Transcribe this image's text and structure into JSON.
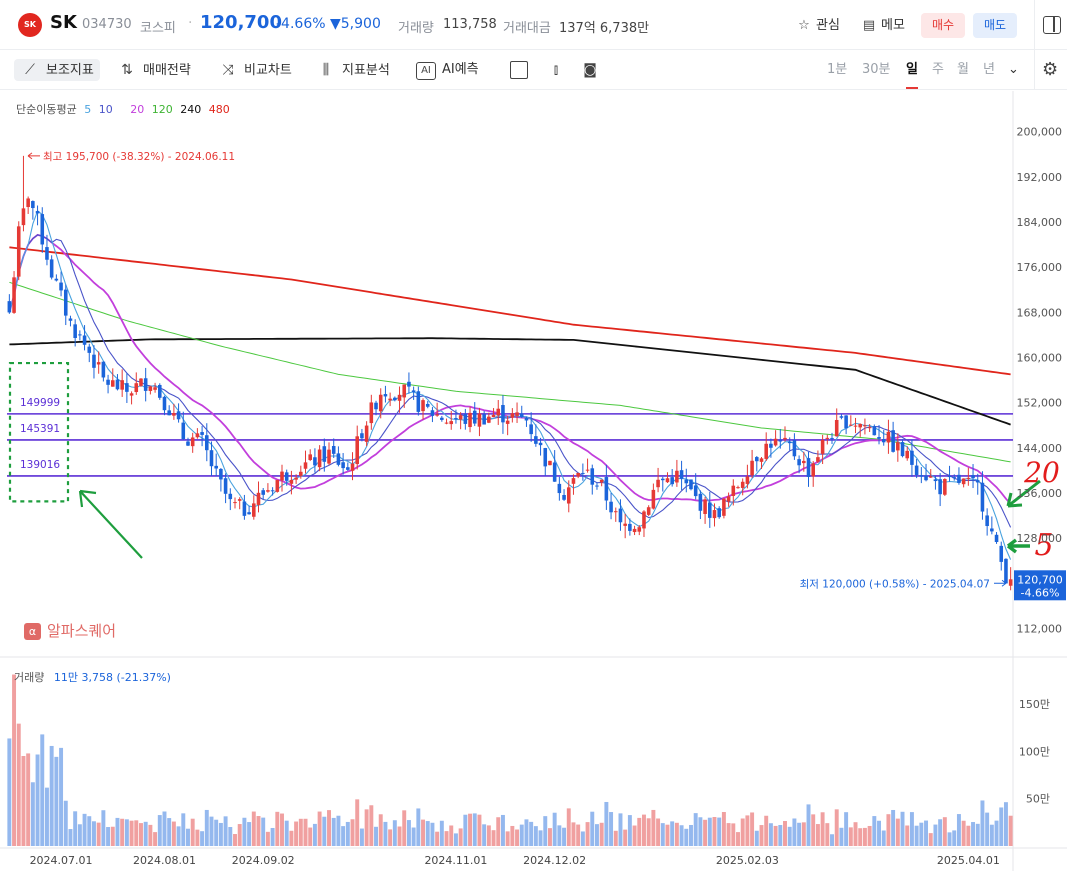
{
  "header": {
    "logo_text": "SK",
    "name": "SK",
    "code": "034730",
    "market": "코스피",
    "separator": "·",
    "price": "120,700",
    "change_pct": "-4.66%",
    "change": "▼5,900",
    "volume_label": "거래량",
    "volume_value": "113,758",
    "amount_label": "거래대금",
    "amount_value": "137억 6,738만",
    "watch_label": "관심",
    "memo_label": "메모",
    "buy_label": "매수",
    "sell_label": "매도",
    "up_color": "#e53935",
    "down_color": "#1b64da"
  },
  "toolbar": {
    "indicator_label": "보조지표",
    "strategy_label": "매매전략",
    "compare_label": "비교차트",
    "analysis_label": "지표분석",
    "ai_label": "AI예측",
    "periods": [
      "1분",
      "30분",
      "일",
      "주",
      "월",
      "년"
    ],
    "active_period": "일"
  },
  "ma_legend": {
    "title": "단순이동평균",
    "items": [
      {
        "label": "5",
        "color": "#4aa3df"
      },
      {
        "label": "10",
        "color": "#4a54c9"
      },
      {
        "label": "20",
        "color": "#c23fdc"
      },
      {
        "label": "120",
        "color": "#4cc83f"
      },
      {
        "label": "240",
        "color": "#111111"
      },
      {
        "label": "480",
        "color": "#e0251b"
      }
    ]
  },
  "brand": {
    "icon": "α",
    "label": "알파스퀘어"
  },
  "chart_data": {
    "type": "candlestick",
    "y_axis": {
      "ticks": [
        "200,000",
        "192,000",
        "184,000",
        "176,000",
        "168,000",
        "160,000",
        "152,000",
        "144,000",
        "136,000",
        "128,000",
        "120,000",
        "112,000"
      ],
      "range": [
        108000,
        204000
      ]
    },
    "x_axis": {
      "ticks": [
        "2024.07.01",
        "2024.08.01",
        "2024.09.02",
        "2024.11.01",
        "2024.12.02",
        "2025.02.03",
        "2025.04.01"
      ]
    },
    "close_keyframes": [
      [
        0,
        168000
      ],
      [
        2,
        182000
      ],
      [
        4,
        189000
      ],
      [
        6,
        184000
      ],
      [
        9,
        175000
      ],
      [
        13,
        166000
      ],
      [
        17,
        161000
      ],
      [
        20,
        156000
      ],
      [
        25,
        154000
      ],
      [
        30,
        156000
      ],
      [
        34,
        151000
      ],
      [
        37,
        146000
      ],
      [
        41,
        145000
      ],
      [
        44,
        139000
      ],
      [
        47,
        134000
      ],
      [
        50,
        133000
      ],
      [
        54,
        136000
      ],
      [
        58,
        139000
      ],
      [
        63,
        141000
      ],
      [
        68,
        143000
      ],
      [
        72,
        140000
      ],
      [
        75,
        147000
      ],
      [
        79,
        154000
      ],
      [
        84,
        154000
      ],
      [
        88,
        151000
      ],
      [
        93,
        149000
      ],
      [
        98,
        149000
      ],
      [
        104,
        150000
      ],
      [
        110,
        149000
      ],
      [
        114,
        142000
      ],
      [
        118,
        136000
      ],
      [
        122,
        140000
      ],
      [
        126,
        137000
      ],
      [
        130,
        130000
      ],
      [
        134,
        131000
      ],
      [
        138,
        138000
      ],
      [
        142,
        139000
      ],
      [
        146,
        135000
      ],
      [
        150,
        132000
      ],
      [
        154,
        136000
      ],
      [
        158,
        142000
      ],
      [
        162,
        145000
      ],
      [
        166,
        144000
      ],
      [
        170,
        140000
      ],
      [
        174,
        146000
      ],
      [
        178,
        149000
      ],
      [
        182,
        148000
      ],
      [
        186,
        146000
      ],
      [
        190,
        143000
      ],
      [
        194,
        140000
      ],
      [
        198,
        137000
      ],
      [
        202,
        138000
      ],
      [
        206,
        137000
      ],
      [
        210,
        126000
      ],
      [
        212,
        121500
      ],
      [
        213,
        120700
      ]
    ],
    "high": {
      "label": "최고 195,700 (-38.32%) - 2024.06.11",
      "value": 195700,
      "bar_index": 3
    },
    "low": {
      "label": "최저 120,000 (+0.58%) - 2025.04.07",
      "value": 120000,
      "bar_index": 212
    },
    "last_price": {
      "price_label": "120,700",
      "pct_label": "-4.66%",
      "value": 120700
    },
    "moving_averages": [
      {
        "period": 480,
        "color": "#e0251b",
        "keyframes": [
          [
            0,
            179500
          ],
          [
            60,
            173800
          ],
          [
            120,
            165800
          ],
          [
            180,
            160800
          ],
          [
            213,
            157000
          ]
        ]
      },
      {
        "period": 240,
        "color": "#111111",
        "keyframes": [
          [
            0,
            162300
          ],
          [
            30,
            163200
          ],
          [
            90,
            163400
          ],
          [
            120,
            163100
          ],
          [
            180,
            157800
          ],
          [
            213,
            148100
          ]
        ]
      },
      {
        "period": 120,
        "color": "#4cc83f",
        "keyframes": [
          [
            0,
            173300
          ],
          [
            25,
            166500
          ],
          [
            45,
            162000
          ],
          [
            70,
            157000
          ],
          [
            95,
            154000
          ],
          [
            130,
            151500
          ],
          [
            160,
            147500
          ],
          [
            185,
            145500
          ],
          [
            213,
            141500
          ]
        ]
      }
    ],
    "horizontal_lines": [
      {
        "value": 149999,
        "label": "149999"
      },
      {
        "value": 145391,
        "label": "145391"
      },
      {
        "value": 139016,
        "label": "139016"
      }
    ],
    "volume": {
      "legend_label": "거래량",
      "legend_value": "11만 3,758 (-21.37%)",
      "ticks": [
        "150만",
        "100만",
        "50만"
      ],
      "range": [
        0,
        1900000
      ]
    },
    "hand_annotations": [
      "20",
      "5"
    ]
  }
}
